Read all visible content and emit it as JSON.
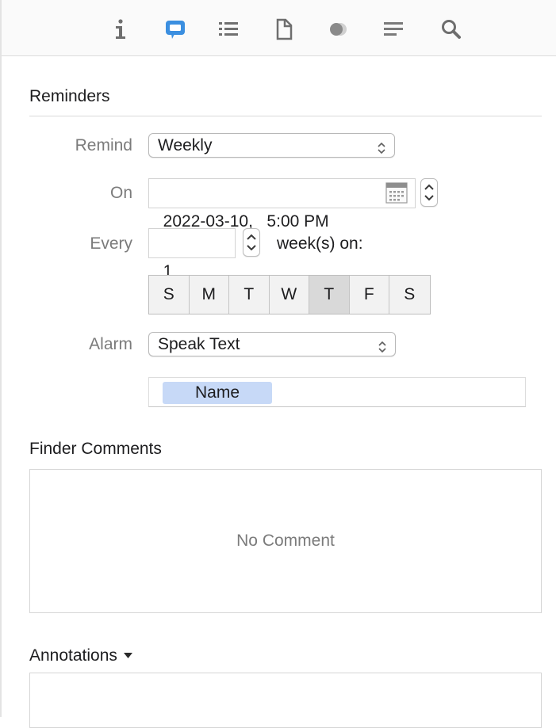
{
  "toolbar": {
    "icons": [
      "info-icon",
      "comment-bubble-icon",
      "list-icon",
      "document-icon",
      "overlapping-circles-icon",
      "lines-icon",
      "search-icon"
    ],
    "selected_icon": "comment-bubble-icon",
    "accent_color": "#3b8fe0"
  },
  "reminders": {
    "title": "Reminders",
    "remind": {
      "label": "Remind",
      "value": "Weekly"
    },
    "on": {
      "label": "On",
      "value": "2022-03-10,   5:00 PM"
    },
    "every": {
      "label": "Every",
      "value": "1",
      "suffix": "week(s) on:"
    },
    "days": [
      {
        "label": "S",
        "selected": false
      },
      {
        "label": "M",
        "selected": false
      },
      {
        "label": "T",
        "selected": false
      },
      {
        "label": "W",
        "selected": false
      },
      {
        "label": "T",
        "selected": true
      },
      {
        "label": "F",
        "selected": false
      },
      {
        "label": "S",
        "selected": false
      }
    ],
    "alarm": {
      "label": "Alarm",
      "value": "Speak Text"
    },
    "token": "Name"
  },
  "finder_comments": {
    "title": "Finder Comments",
    "placeholder": "No Comment"
  },
  "annotations": {
    "title": "Annotations"
  }
}
